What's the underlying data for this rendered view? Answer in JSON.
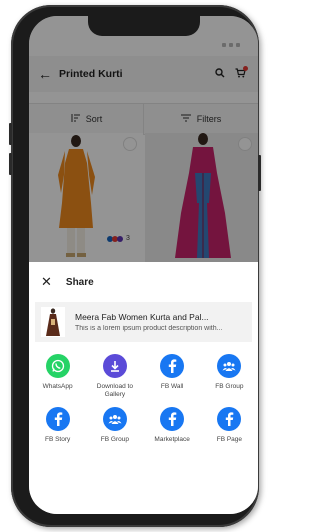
{
  "colors": {
    "facebook": "#1877f2",
    "whatsapp": "#25d366",
    "download": "#5b4bd8",
    "accent_red": "#e53935"
  },
  "appbar": {
    "back_icon": "arrow-left-icon",
    "title": "Printed Kurti",
    "search_icon": "search-icon",
    "cart_icon": "cart-icon"
  },
  "sortbar": {
    "sort_label": "Sort",
    "filters_label": "Filters"
  },
  "products": [
    {
      "swatch_count": "3",
      "image": "orange-kurti"
    },
    {
      "image": "pink-kurta"
    }
  ],
  "share_sheet": {
    "title": "Share",
    "close_icon": "close-icon",
    "product": {
      "name": "Meera Fab Women Kurta and Pal...",
      "description": "This is a lorem ipsum product description with..."
    },
    "options": [
      [
        {
          "label": "WhatsApp",
          "icon": "whatsapp-icon"
        },
        {
          "label": "Download to Gallery",
          "icon": "download-icon"
        },
        {
          "label": "FB Wall",
          "icon": "facebook-icon"
        },
        {
          "label": "FB Group",
          "icon": "group-icon"
        }
      ],
      [
        {
          "label": "FB Story",
          "icon": "facebook-icon"
        },
        {
          "label": "FB Group",
          "icon": "group-icon"
        },
        {
          "label": "Marketplace",
          "icon": "facebook-icon"
        },
        {
          "label": "FB Page",
          "icon": "facebook-icon"
        }
      ]
    ]
  }
}
